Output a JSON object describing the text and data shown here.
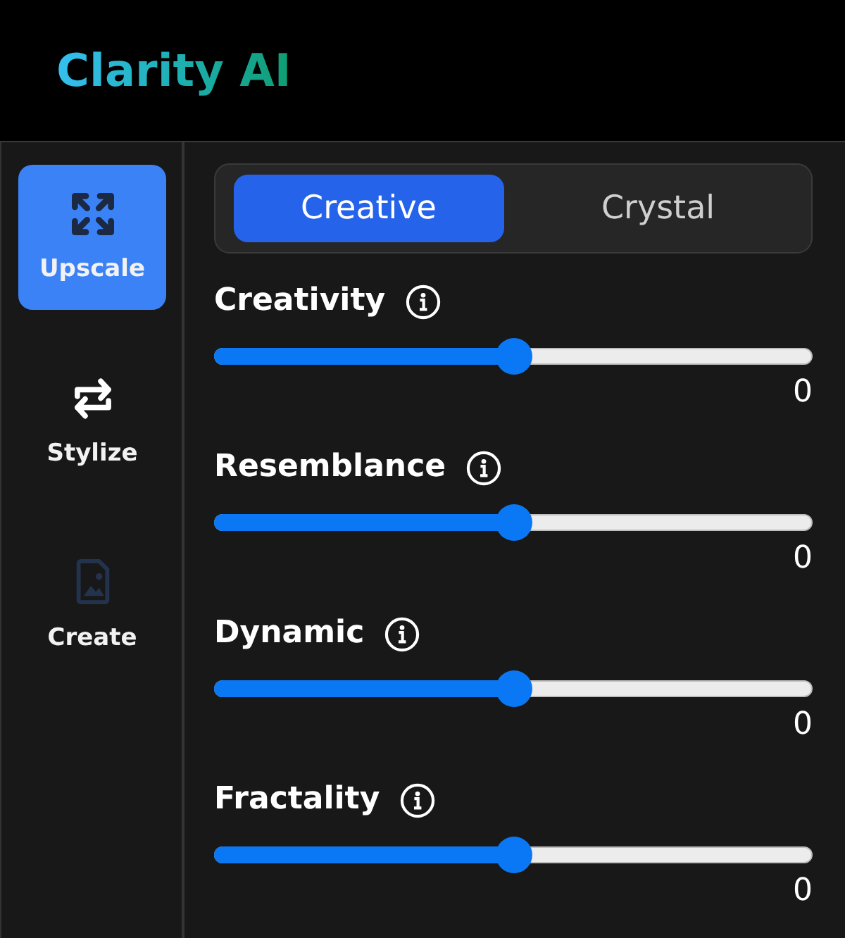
{
  "app": {
    "title": "Clarity AI"
  },
  "sidebar": {
    "items": [
      {
        "label": "Upscale",
        "kind": "expand",
        "selected": true
      },
      {
        "label": "Stylize",
        "kind": "swap",
        "selected": false
      },
      {
        "label": "Create",
        "kind": "image",
        "selected": false
      }
    ]
  },
  "mode_tabs": [
    {
      "label": "Creative",
      "selected": true
    },
    {
      "label": "Crystal",
      "selected": false
    }
  ],
  "sliders": [
    {
      "label": "Creativity",
      "level": 0.5,
      "reading": "0"
    },
    {
      "label": "Resemblance",
      "level": 0.5,
      "reading": "0"
    },
    {
      "label": "Dynamic",
      "level": 0.5,
      "reading": "0"
    },
    {
      "label": "Fractality",
      "level": 0.5,
      "reading": "0"
    }
  ]
}
